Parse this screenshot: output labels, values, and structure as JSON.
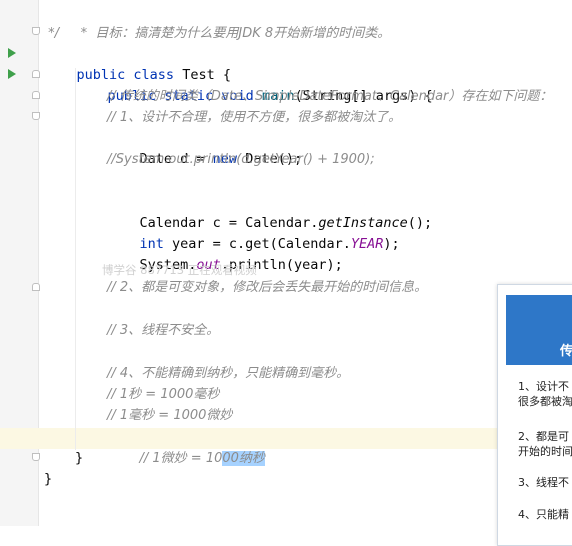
{
  "editor": {
    "lines": [
      {
        "text_a": " *  ",
        "text_b": "目标：搞清楚为什么要用JDK 8开始新增的时间类。"
      },
      {
        "text": " */"
      },
      {
        "kw": "public class",
        "rest": " Test {"
      },
      {
        "kw": "public static void",
        "fn": "main",
        "rest": "(String[] args) {"
      },
      {
        "comment": "// 传统的时间类（Date、SimpleDateFormat、Calendar）存在如下问题："
      },
      {
        "comment": "// 1、设计不合理，使用不方便，很多都被淘汰了。"
      },
      {
        "type": "Date",
        "var": " d = ",
        "kw": "new",
        "rest": " Date();"
      },
      {
        "comment": "//System.out.println(d.getYear() + 1900);"
      },
      {
        "a": "Calendar c = Calendar.",
        "b": "getInstance",
        "c": "();"
      },
      {
        "kw": "int",
        "a": " year = c.get(Calendar.",
        "b": "YEAR",
        "c": ");"
      },
      {
        "a": "System.",
        "b": "out",
        "c": ".println(year);"
      },
      {
        "comment": "// 2、都是可变对象，修改后会丢失最开始的时间信息。"
      },
      {
        "comment": "// 3、线程不安全。"
      },
      {
        "comment": "// 4、不能精确到纳秒，只能精确到毫秒。"
      },
      {
        "comment": "// 1秒 = 1000毫秒"
      },
      {
        "comment": "// 1毫秒 = 1000微妙"
      },
      {
        "comment_a": "// 1微妙 = 10",
        "comment_sel": "00纳秒"
      },
      {
        "text": "}"
      },
      {
        "text": "}"
      }
    ]
  },
  "watermark": "博学谷 887713 正在观看视频",
  "slide": {
    "title": "传",
    "items": [
      "1、设计不\n很多都被淘",
      "2、都是可\n开始的时间",
      "3、线程不",
      "4、只能精"
    ]
  }
}
